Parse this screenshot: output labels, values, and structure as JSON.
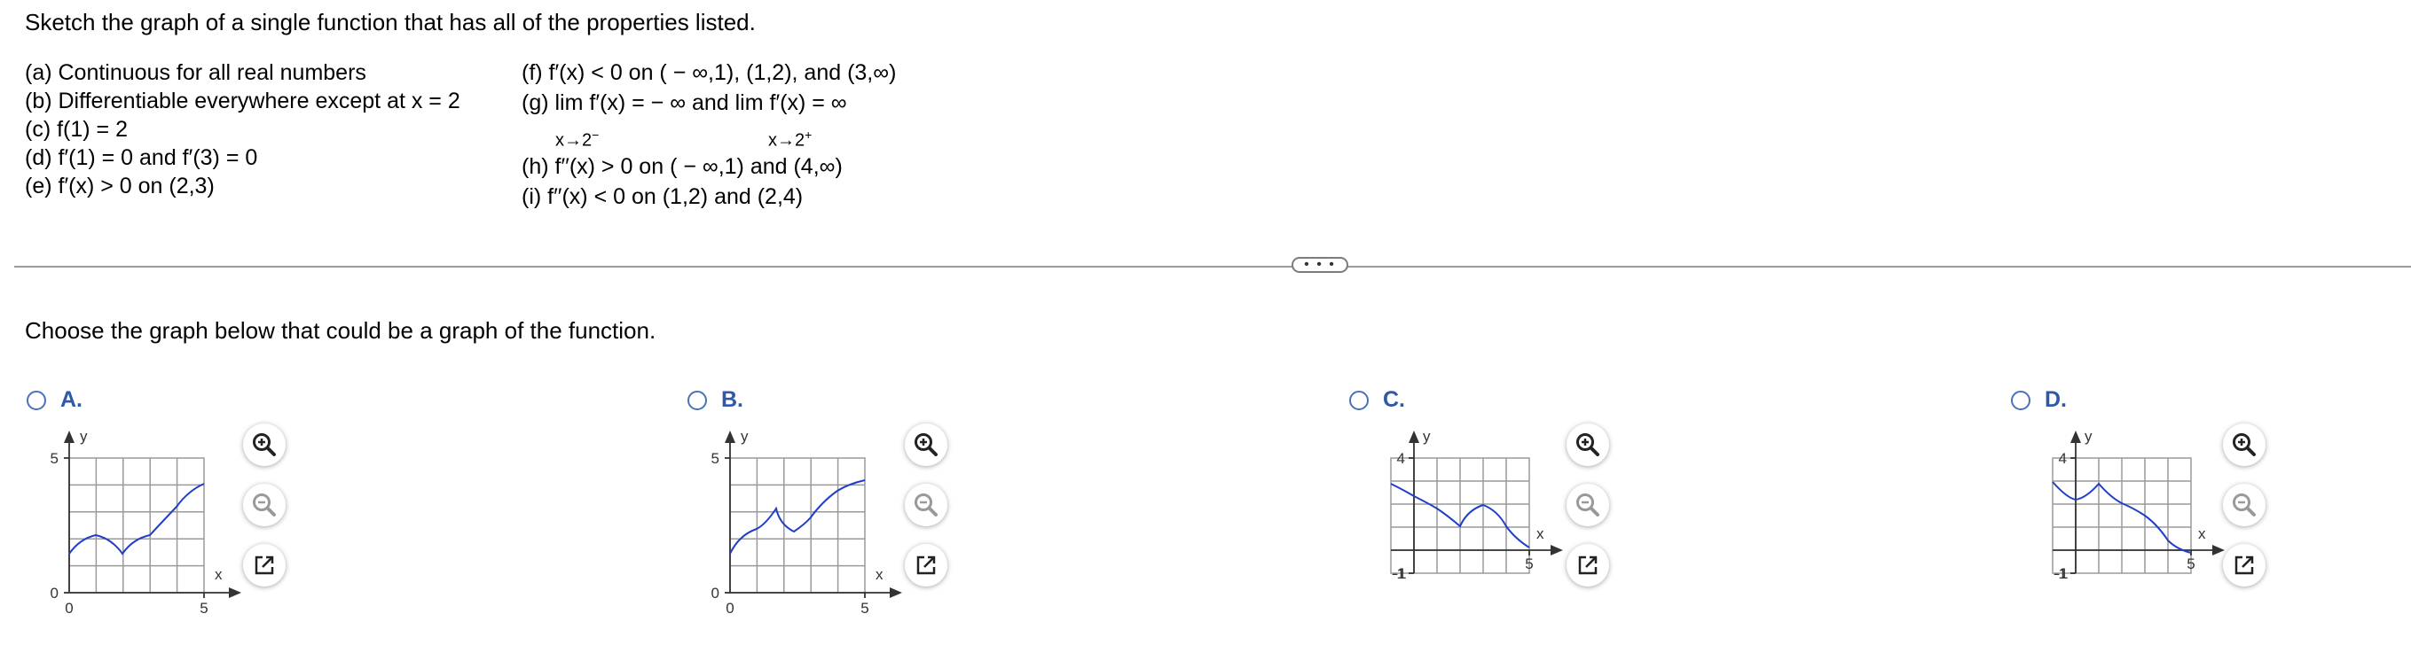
{
  "question": {
    "prompt": "Sketch the graph of a single function that has all of the properties listed.",
    "properties_left": [
      "(a) Continuous for all real numbers",
      "(b) Differentiable everywhere except at x = 2",
      "(c) f(1) = 2",
      "(d) f′(1) = 0 and f′(3) = 0",
      "(e) f′(x) > 0 on (2,3)"
    ],
    "properties_right": {
      "f": "(f) f′(x) < 0 on ( − ∞,1), (1,2), and (3,∞)",
      "g": "(g)  lim  f′(x) = − ∞ and  lim  f′(x) = ∞",
      "g_sub_left": "x→2",
      "g_sup_left": "−",
      "g_sub_right": "x→2",
      "g_sup_right": "+",
      "h": "(h) f′′(x) > 0 on ( − ∞,1) and (4,∞)",
      "i": "(i) f′′(x) < 0 on (1,2) and (2,4)"
    },
    "more_button": "• • •",
    "choose_prompt": "Choose the graph below that could be a graph of the function."
  },
  "options": [
    {
      "letter": "A.",
      "y_top": "5",
      "y_bottom": "0",
      "x_left": "0",
      "x_right": "5",
      "x_axis": "x",
      "y_axis": "y"
    },
    {
      "letter": "B.",
      "y_top": "5",
      "y_bottom": "0",
      "x_left": "0",
      "x_right": "5",
      "x_axis": "x",
      "y_axis": "y"
    },
    {
      "letter": "C.",
      "y_top": "4",
      "y_bottom": "-1",
      "x_left": "-1",
      "x_right": "5",
      "x_axis": "x",
      "y_axis": "y"
    },
    {
      "letter": "D.",
      "y_top": "4",
      "y_bottom": "-1",
      "x_left": "-1",
      "x_right": "5",
      "x_axis": "x",
      "y_axis": "y"
    }
  ],
  "icons": {
    "zoom_in": "zoom-in-icon",
    "zoom_out": "zoom-out-icon",
    "popout": "external-link-icon"
  },
  "colors": {
    "curve": "#1f3fc7",
    "option_letter": "#2f59a8",
    "radio": "#4a72b8",
    "grid": "#9a9a9a"
  }
}
